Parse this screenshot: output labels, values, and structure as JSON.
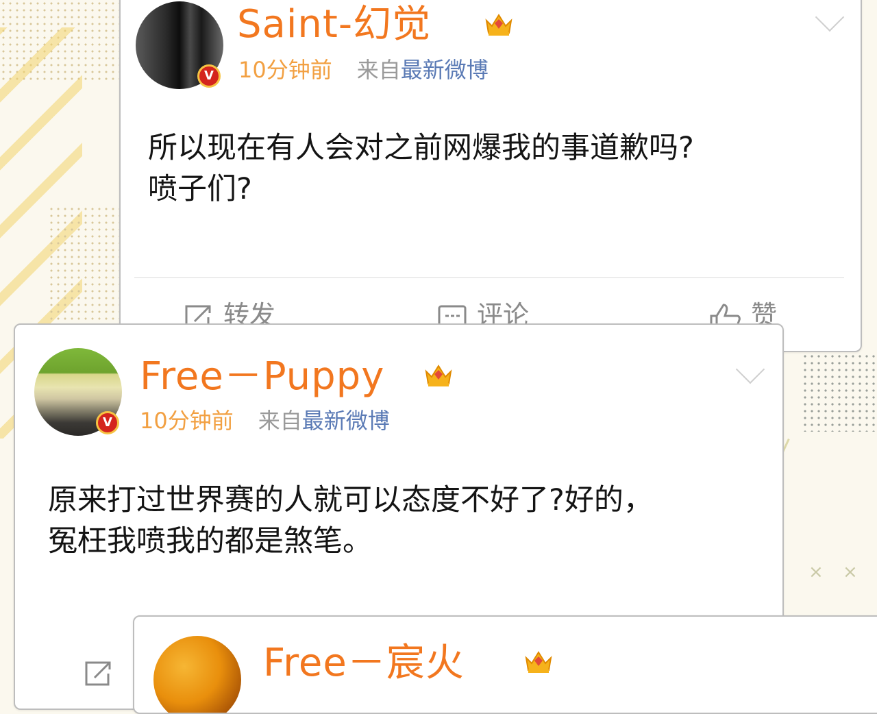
{
  "colors": {
    "username": "#f2771f",
    "time": "#f2a042",
    "source_link": "#5a7ab5",
    "from_label": "#9a9a9a",
    "text": "#141414",
    "verified_badge": "#d4251d"
  },
  "posts": [
    {
      "username": "Saint-幻觉",
      "time": "10分钟前",
      "from_label": "来自",
      "source": "最新微博",
      "text_lines": [
        "所以现在有人会对之前网爆我的事道歉吗?",
        "喷子们?"
      ],
      "actions": {
        "repost": "转发",
        "comment": "评论",
        "like": "赞"
      },
      "badge": "V",
      "icons": [
        "crown-icon",
        "chevron-down-icon",
        "verified-icon"
      ]
    },
    {
      "username": "Free－Puppy",
      "time": "10分钟前",
      "from_label": "来自",
      "source": "最新微博",
      "text_lines": [
        "原来打过世界赛的人就可以态度不好了?好的，",
        "冤枉我喷我的都是煞笔。"
      ],
      "badge": "V",
      "icons": [
        "crown-icon",
        "chevron-down-icon",
        "verified-icon"
      ]
    },
    {
      "username": "Free－宸火",
      "icons": [
        "crown-icon"
      ]
    }
  ]
}
